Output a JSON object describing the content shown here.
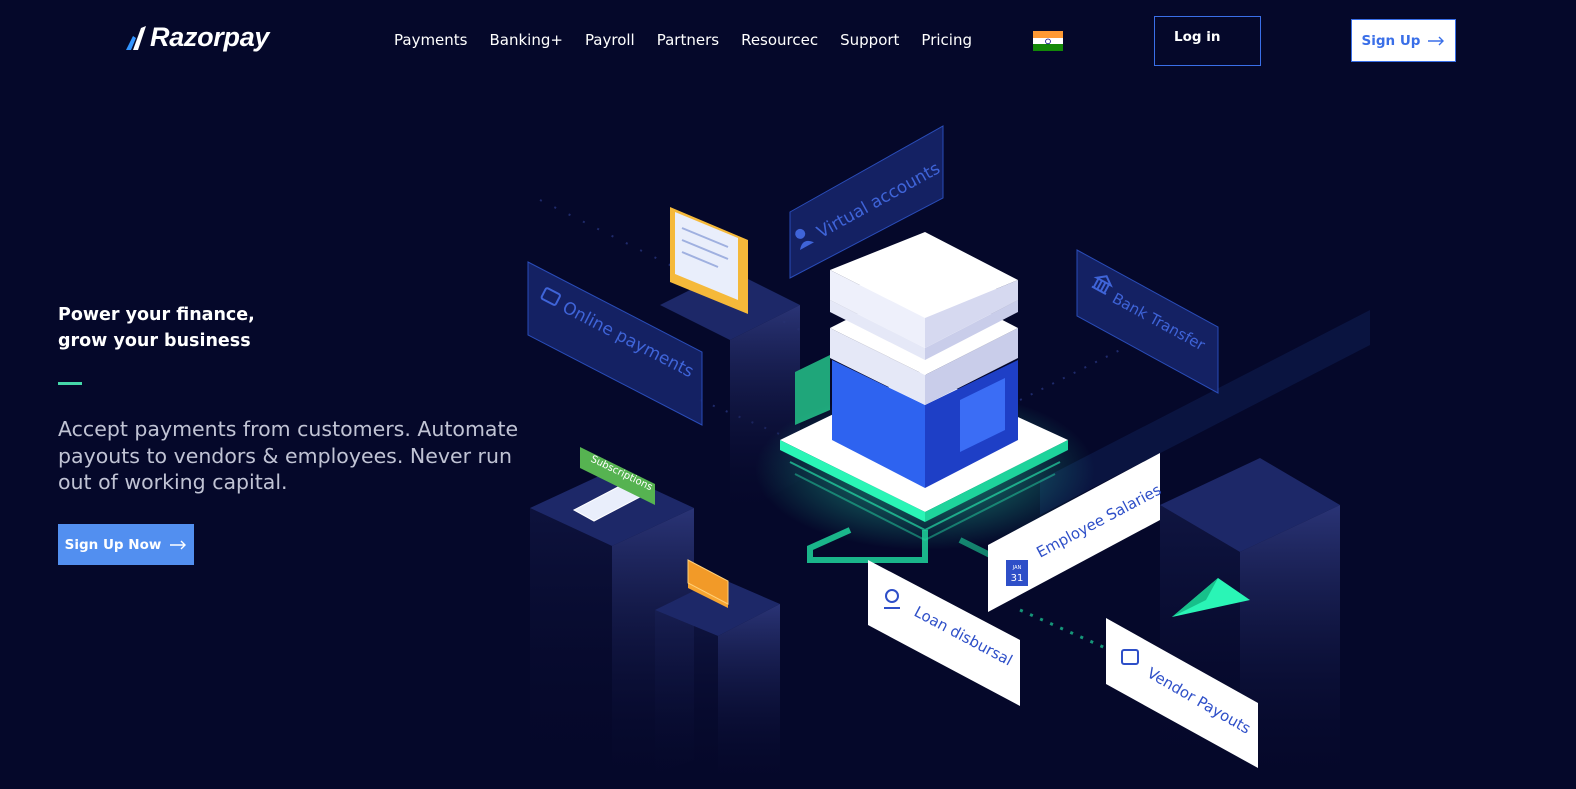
{
  "brand": {
    "name": "Razorpay"
  },
  "nav": {
    "items": [
      "Payments",
      "Banking+",
      "Payroll",
      "Partners",
      "Resourcec",
      "Support",
      "Pricing"
    ]
  },
  "header": {
    "flag_icon": "india-flag-icon",
    "login_label": "Log in",
    "signup_label": "Sign Up"
  },
  "hero": {
    "title_line1": "Power your finance,",
    "title_line2": "grow your business",
    "subtitle": "Accept payments from customers. Automate payouts to vendors & employees. Never run out of working capital.",
    "cta_label": "Sign Up Now"
  },
  "illustration": {
    "labels": {
      "virtual_accounts": "Virtual accounts",
      "online_payments": "Online payments",
      "bank_transfer": "Bank Transfer",
      "subscriptions": "Subscriptions",
      "employee_salaries": "Employee Salaries",
      "loan_disbursal": "Loan disbursal",
      "vendor_payouts": "Vendor Payouts",
      "calendar_month": "JAN",
      "calendar_day": "31"
    }
  },
  "colors": {
    "background": "#05082a",
    "accent_blue": "#528ff0",
    "button_border": "#3a6fe8",
    "accent_green": "#45d7a9",
    "panel_blue": "#1d2f80"
  }
}
